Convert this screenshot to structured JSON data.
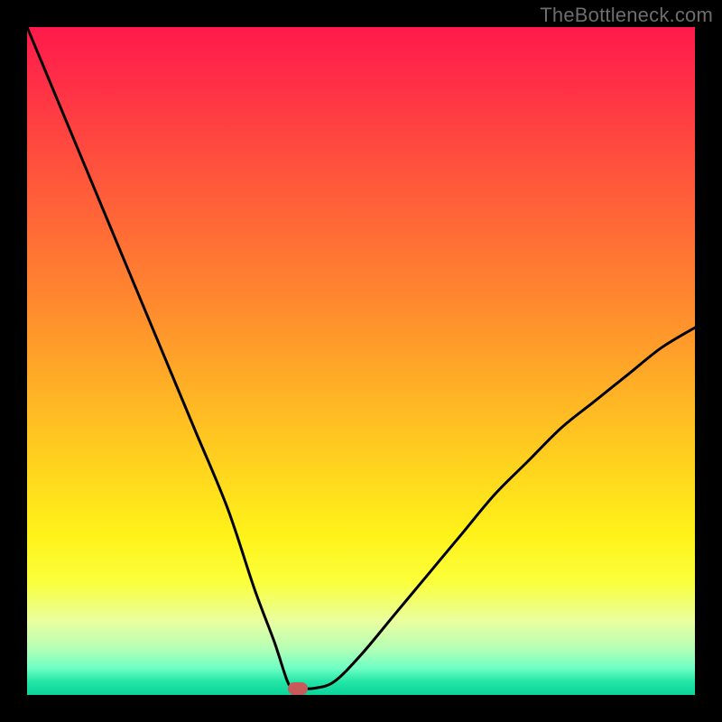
{
  "watermark": "TheBottleneck.com",
  "colors": {
    "curve_stroke": "#000000",
    "marker_fill": "#c85a5a",
    "background": "#000000"
  },
  "chart_data": {
    "type": "line",
    "title": "",
    "xlabel": "",
    "ylabel": "",
    "xlim": [
      0,
      100
    ],
    "ylim": [
      0,
      100
    ],
    "grid": false,
    "description": "V-shaped bottleneck curve over a vertical red→yellow→green gradient. Minimum (near zero) sits around x≈40. Left branch starts near y≈100 at x=0; right branch rises to y≈55 at x=100. A small rounded red marker sits at the minimum.",
    "series": [
      {
        "name": "bottleneck-curve",
        "x": [
          0,
          5,
          10,
          15,
          20,
          25,
          30,
          34,
          37,
          39,
          40,
          41,
          43,
          46,
          50,
          55,
          60,
          65,
          70,
          75,
          80,
          85,
          90,
          95,
          100
        ],
        "y": [
          100,
          88,
          76,
          64,
          52,
          40,
          28,
          16,
          8,
          2,
          1,
          1,
          1,
          2,
          6,
          12,
          18,
          24,
          30,
          35,
          40,
          44,
          48,
          52,
          55
        ]
      }
    ],
    "marker": {
      "x": 40.5,
      "y": 1
    }
  }
}
